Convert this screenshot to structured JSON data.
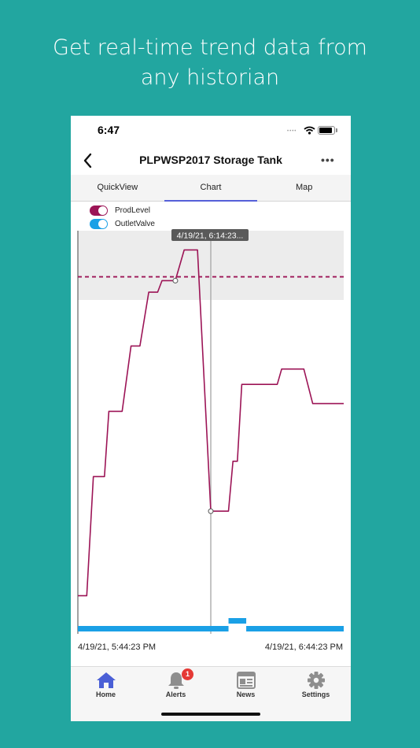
{
  "headline": {
    "line1": "Get real-time trend data from",
    "line2": "any historian"
  },
  "status_bar": {
    "time": "6:47",
    "signal": "••••"
  },
  "navbar": {
    "title": "PLPWSP2017 Storage Tank",
    "more": "•••"
  },
  "tabs": [
    {
      "label": "QuickView",
      "active": false
    },
    {
      "label": "Chart",
      "active": true
    },
    {
      "label": "Map",
      "active": false
    }
  ],
  "legend": [
    {
      "label": "ProdLevel",
      "color": "#9c1456",
      "on": true
    },
    {
      "label": "OutletValve",
      "color": "#1aa0e6",
      "on": true
    }
  ],
  "chart": {
    "cursor_label": "4/19/21, 6:14:23...",
    "start_label": "4/19/21, 5:44:23 PM",
    "end_label": "4/19/21, 6:44:23 PM"
  },
  "tabbar": [
    {
      "label": "Home",
      "icon": "home-icon",
      "active": true
    },
    {
      "label": "Alerts",
      "icon": "bell-icon",
      "badge": "1"
    },
    {
      "label": "News",
      "icon": "newspaper-icon"
    },
    {
      "label": "Settings",
      "icon": "gear-icon"
    }
  ],
  "colors": {
    "background": "#22A6A0",
    "accent": "#5560d8",
    "prodlevel": "#9c1456",
    "outletvalve": "#1aa0e6"
  },
  "chart_data": {
    "type": "line",
    "x_range": [
      "4/19/21, 5:44:23 PM",
      "4/19/21, 6:44:23 PM"
    ],
    "cursor_x": "4/19/21, 6:14:23...",
    "series": [
      {
        "name": "ProdLevel",
        "x": [
          0,
          2,
          3.5,
          6,
          7,
          10,
          12,
          14,
          16,
          18,
          19,
          22,
          24,
          27,
          30,
          34,
          35,
          36,
          37,
          38,
          41,
          45,
          46,
          51,
          53,
          56,
          59,
          60
        ],
        "values": [
          5,
          5,
          36,
          36,
          53,
          53,
          70,
          70,
          84,
          84,
          87,
          87,
          95,
          95,
          27,
          27,
          40,
          40,
          60,
          60,
          60,
          60,
          64,
          64,
          55,
          55,
          55,
          55
        ],
        "threshold": 88
      },
      {
        "name": "OutletValve",
        "x": [
          0,
          34,
          34,
          38,
          38,
          60
        ],
        "values": [
          0,
          0,
          1,
          1,
          0,
          0
        ]
      }
    ]
  }
}
